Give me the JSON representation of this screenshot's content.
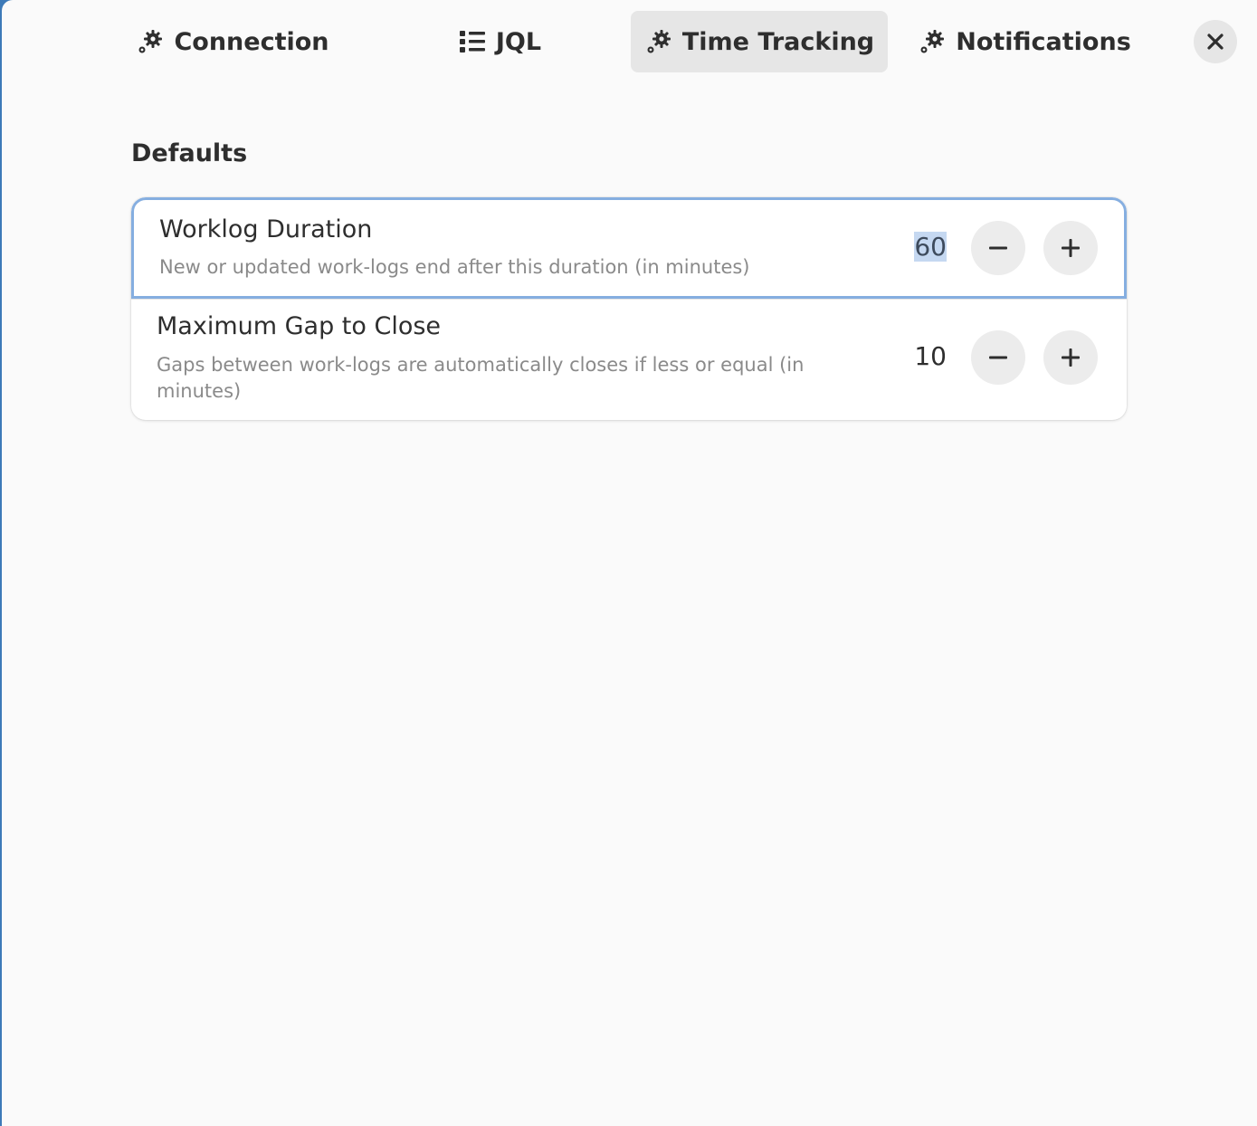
{
  "tabs": [
    {
      "label": "Connection",
      "icon": "gears-icon",
      "active": false
    },
    {
      "label": "JQL",
      "icon": "list-icon",
      "active": false
    },
    {
      "label": "Time Tracking",
      "icon": "gears-icon",
      "active": true
    },
    {
      "label": "Notifications",
      "icon": "gears-icon",
      "active": false
    }
  ],
  "close_icon": "close-icon",
  "section": {
    "title": "Defaults"
  },
  "settings": [
    {
      "title": "Worklog Duration",
      "subtitle": "New or updated work-logs end after this duration (in minutes)",
      "value": "60",
      "value_selected": true
    },
    {
      "title": "Maximum Gap to Close",
      "subtitle": "Gaps between work-logs are automatically closes if less or equal (in minutes)",
      "value": "10",
      "value_selected": false
    }
  ],
  "colors": {
    "accent_focus": "#85aee0",
    "selection": "#c5d8f1",
    "background": "#fafafa"
  }
}
